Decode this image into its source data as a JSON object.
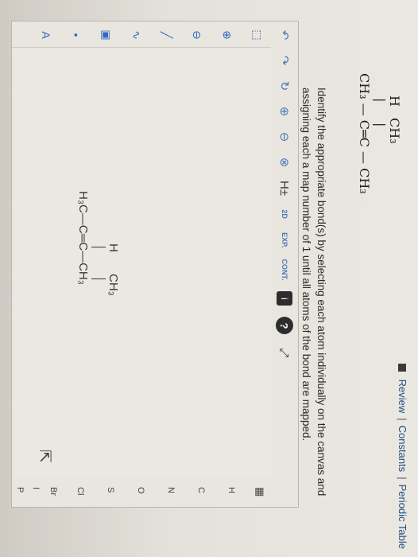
{
  "header": {
    "links": [
      "Review",
      "Constants",
      "Periodic Table"
    ],
    "separator": "|"
  },
  "question": {
    "top_labels": [
      "H",
      "CH₃"
    ],
    "bond_marks": [
      "|",
      "|"
    ],
    "chain": "CH₃ — C═C — CH₃",
    "instruction": "Identify the appropriate bond(s) by selecting each atom individually on the canvas and assigning each a map number of 1 until all atoms of the bond are mapped."
  },
  "toolbar": {
    "undo": "↶",
    "redo": "↷",
    "reset": "↻",
    "zoom_in": "⊕",
    "zoom_out": "⊖",
    "clear": "⊗",
    "h_toggle": "H±",
    "two_d": "2D",
    "exp": "EXP.",
    "cont": "CONT.",
    "info": "i",
    "help": "?",
    "fullscreen": "⤢"
  },
  "left_tools": [
    "⬚",
    "⊕",
    "⊖",
    "╱",
    "∿",
    "▣",
    "•",
    "A"
  ],
  "canvas_structure": {
    "top_labels": [
      "H",
      "CH₃"
    ],
    "chain": "H₃C—C═C—CH₃"
  },
  "periodic": {
    "grid_icon": "▦",
    "elements": [
      "H",
      "C",
      "N",
      "O",
      "S",
      "Cl",
      "Br",
      "I",
      "P"
    ]
  }
}
